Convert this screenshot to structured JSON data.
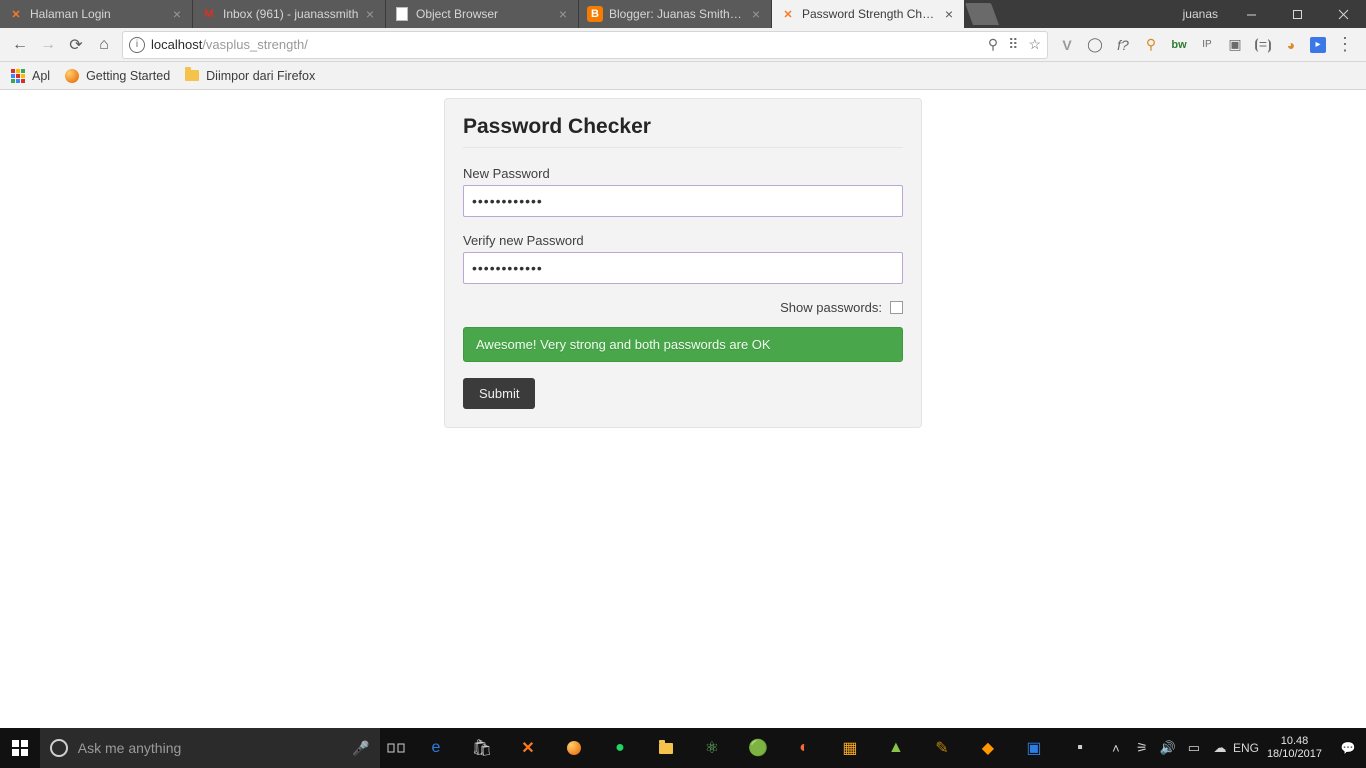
{
  "window": {
    "user": "juanas",
    "tabs": [
      {
        "title": "Halaman Login",
        "favicon": "xampp"
      },
      {
        "title": "Inbox (961) - juanassmith",
        "favicon": "gmail"
      },
      {
        "title": "Object Browser",
        "favicon": "page"
      },
      {
        "title": "Blogger: Juanas Smith Sh",
        "favicon": "blogger"
      },
      {
        "title": "Password Strength Check",
        "favicon": "xampp",
        "active": true
      }
    ]
  },
  "omnibox": {
    "host": "localhost",
    "path": "/vasplus_strength/"
  },
  "bookmarks": {
    "apps_label": "Apl",
    "getting_started": "Getting Started",
    "firefox_folder": "Diimpor dari Firefox"
  },
  "form": {
    "heading": "Password Checker",
    "new_pw_label": "New Password",
    "new_pw_value": "••••••••••••",
    "verify_label": "Verify new Password",
    "verify_value": "••••••••••••",
    "show_label": "Show passwords:",
    "alert": "Awesome! Very strong and both passwords are OK",
    "submit": "Submit"
  },
  "taskbar": {
    "cortana": "Ask me anything",
    "lang": "ENG",
    "time": "10.48",
    "date": "18/10/2017"
  }
}
